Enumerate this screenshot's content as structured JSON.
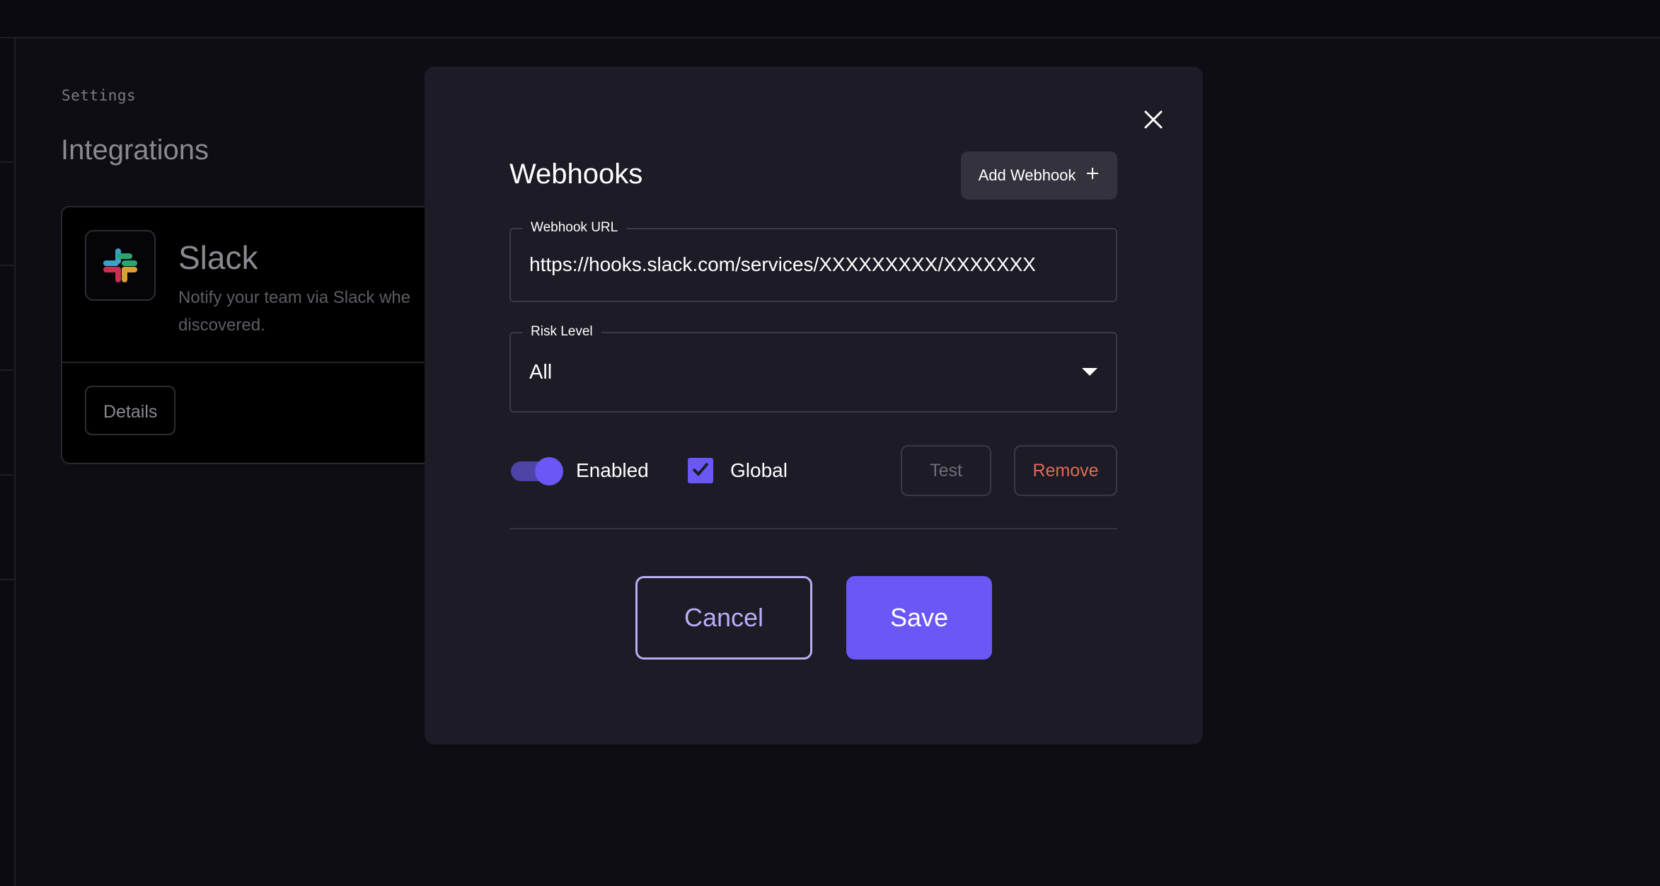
{
  "background": {
    "breadcrumb": "Settings",
    "page_title": "Integrations",
    "card": {
      "logo_icon": "slack-logo-icon",
      "title": "Slack",
      "description_line1": "Notify your team via Slack whe",
      "description_line2": "discovered.",
      "details_label": "Details"
    }
  },
  "modal": {
    "title": "Webhooks",
    "close_icon": "close-icon",
    "add_webhook_label": "Add Webhook",
    "add_icon": "plus-icon",
    "webhook_url": {
      "label": "Webhook URL",
      "value": "https://hooks.slack.com/services/XXXXXXXXX/XXXXXXX"
    },
    "risk_level": {
      "label": "Risk Level",
      "value": "All",
      "caret_icon": "caret-down-icon"
    },
    "enabled": {
      "label": "Enabled",
      "on": true
    },
    "global": {
      "label": "Global",
      "checked": true
    },
    "test_label": "Test",
    "remove_label": "Remove",
    "cancel_label": "Cancel",
    "save_label": "Save"
  },
  "colors": {
    "accent": "#6b57f5",
    "danger": "#e06a52",
    "modal_bg": "#1c1b26",
    "page_bg": "#0e0d13"
  }
}
